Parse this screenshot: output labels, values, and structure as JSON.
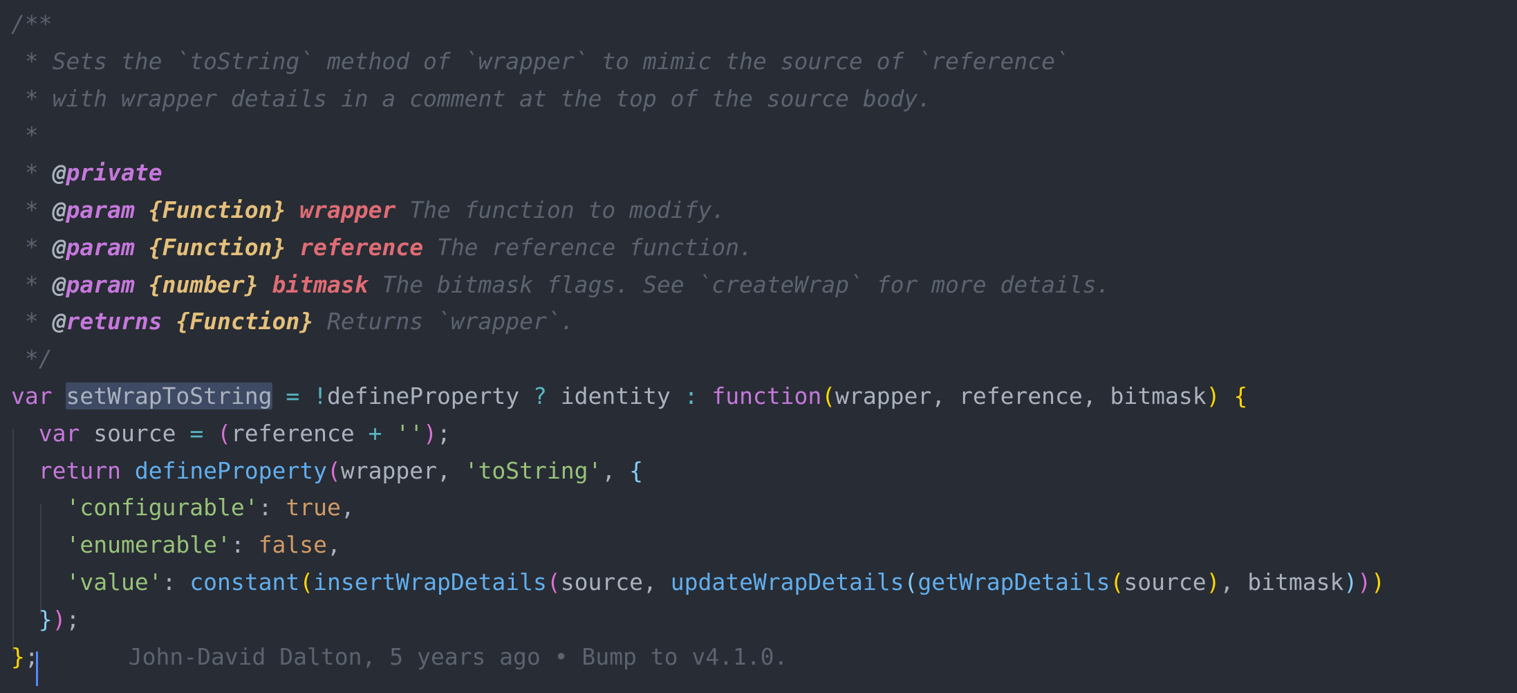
{
  "editor": {
    "theme_colors": {
      "background": "#282c34",
      "comment": "#5c6370",
      "keyword": "#c678dd",
      "function": "#61afef",
      "string": "#98c379",
      "type": "#e5c07b",
      "param": "#e06c75",
      "number_bool": "#d19a66",
      "operator": "#56b6c2",
      "bracket_gold": "#ffd700",
      "bracket_pink": "#da70d6",
      "bracket_blue": "#87cefa",
      "selection": "#3e4a63",
      "cursor": "#528bff"
    },
    "lines": [
      [
        {
          "text": "/**",
          "kind": "comment"
        }
      ],
      [
        {
          "text": " * Sets the `toString` method of `wrapper` to mimic the source of `reference`",
          "kind": "comment"
        }
      ],
      [
        {
          "text": " * with wrapper details in a comment at the top of the source body.",
          "kind": "comment"
        }
      ],
      [
        {
          "text": " *",
          "kind": "comment"
        }
      ],
      [
        {
          "text": " * ",
          "kind": "comment"
        },
        {
          "text": "@",
          "kind": "doc-at"
        },
        {
          "text": "private",
          "kind": "doc-tag"
        }
      ],
      [
        {
          "text": " * ",
          "kind": "comment"
        },
        {
          "text": "@",
          "kind": "doc-at"
        },
        {
          "text": "param",
          "kind": "doc-tag"
        },
        {
          "text": " ",
          "kind": "comment"
        },
        {
          "text": "{Function}",
          "kind": "doc-type"
        },
        {
          "text": " ",
          "kind": "comment"
        },
        {
          "text": "wrapper",
          "kind": "doc-param"
        },
        {
          "text": " The function to modify.",
          "kind": "comment"
        }
      ],
      [
        {
          "text": " * ",
          "kind": "comment"
        },
        {
          "text": "@",
          "kind": "doc-at"
        },
        {
          "text": "param",
          "kind": "doc-tag"
        },
        {
          "text": " ",
          "kind": "comment"
        },
        {
          "text": "{Function}",
          "kind": "doc-type"
        },
        {
          "text": " ",
          "kind": "comment"
        },
        {
          "text": "reference",
          "kind": "doc-param"
        },
        {
          "text": " The reference function.",
          "kind": "comment"
        }
      ],
      [
        {
          "text": " * ",
          "kind": "comment"
        },
        {
          "text": "@",
          "kind": "doc-at"
        },
        {
          "text": "param",
          "kind": "doc-tag"
        },
        {
          "text": " ",
          "kind": "comment"
        },
        {
          "text": "{number}",
          "kind": "doc-type"
        },
        {
          "text": " ",
          "kind": "comment"
        },
        {
          "text": "bitmask",
          "kind": "doc-param"
        },
        {
          "text": " The bitmask flags. See `createWrap` for more details.",
          "kind": "comment"
        }
      ],
      [
        {
          "text": " * ",
          "kind": "comment"
        },
        {
          "text": "@",
          "kind": "doc-at"
        },
        {
          "text": "returns",
          "kind": "doc-tag"
        },
        {
          "text": " ",
          "kind": "comment"
        },
        {
          "text": "{Function}",
          "kind": "doc-type"
        },
        {
          "text": " Returns `wrapper`.",
          "kind": "comment"
        }
      ],
      [
        {
          "text": " */",
          "kind": "comment"
        }
      ],
      [
        {
          "text": "var",
          "kind": "keyword"
        },
        {
          "text": " ",
          "kind": "plain"
        },
        {
          "text": "setWrapToString",
          "kind": "selected"
        },
        {
          "text": " ",
          "kind": "plain"
        },
        {
          "text": "=",
          "kind": "operator"
        },
        {
          "text": " ",
          "kind": "plain"
        },
        {
          "text": "!",
          "kind": "operator"
        },
        {
          "text": "defineProperty ",
          "kind": "plain"
        },
        {
          "text": "?",
          "kind": "operator"
        },
        {
          "text": " identity ",
          "kind": "plain"
        },
        {
          "text": ":",
          "kind": "operator"
        },
        {
          "text": " ",
          "kind": "plain"
        },
        {
          "text": "function",
          "kind": "keyword"
        },
        {
          "text": "(",
          "kind": "bracket-gold"
        },
        {
          "text": "wrapper, reference, bitmask",
          "kind": "plain"
        },
        {
          "text": ")",
          "kind": "bracket-gold"
        },
        {
          "text": " ",
          "kind": "plain"
        },
        {
          "text": "{",
          "kind": "bracket-gold"
        }
      ],
      [
        {
          "text": "  ",
          "kind": "plain"
        },
        {
          "text": "var",
          "kind": "keyword"
        },
        {
          "text": " source ",
          "kind": "plain"
        },
        {
          "text": "=",
          "kind": "operator"
        },
        {
          "text": " ",
          "kind": "plain"
        },
        {
          "text": "(",
          "kind": "bracket-pink"
        },
        {
          "text": "reference ",
          "kind": "plain"
        },
        {
          "text": "+",
          "kind": "operator"
        },
        {
          "text": " ",
          "kind": "plain"
        },
        {
          "text": "''",
          "kind": "string"
        },
        {
          "text": ")",
          "kind": "bracket-pink"
        },
        {
          "text": ";",
          "kind": "plain"
        }
      ],
      [
        {
          "text": "  ",
          "kind": "plain"
        },
        {
          "text": "return",
          "kind": "keyword"
        },
        {
          "text": " ",
          "kind": "plain"
        },
        {
          "text": "defineProperty",
          "kind": "function"
        },
        {
          "text": "(",
          "kind": "bracket-pink"
        },
        {
          "text": "wrapper, ",
          "kind": "plain"
        },
        {
          "text": "'toString'",
          "kind": "string"
        },
        {
          "text": ", ",
          "kind": "plain"
        },
        {
          "text": "{",
          "kind": "bracket-blue"
        }
      ],
      [
        {
          "text": "    ",
          "kind": "plain"
        },
        {
          "text": "'configurable'",
          "kind": "string"
        },
        {
          "text": ": ",
          "kind": "plain"
        },
        {
          "text": "true",
          "kind": "number"
        },
        {
          "text": ",",
          "kind": "plain"
        }
      ],
      [
        {
          "text": "    ",
          "kind": "plain"
        },
        {
          "text": "'enumerable'",
          "kind": "string"
        },
        {
          "text": ": ",
          "kind": "plain"
        },
        {
          "text": "false",
          "kind": "number"
        },
        {
          "text": ",",
          "kind": "plain"
        }
      ],
      [
        {
          "text": "    ",
          "kind": "plain"
        },
        {
          "text": "'value'",
          "kind": "string"
        },
        {
          "text": ": ",
          "kind": "plain"
        },
        {
          "text": "constant",
          "kind": "function"
        },
        {
          "text": "(",
          "kind": "bracket-gold"
        },
        {
          "text": "insertWrapDetails",
          "kind": "function"
        },
        {
          "text": "(",
          "kind": "bracket-pink"
        },
        {
          "text": "source, ",
          "kind": "plain"
        },
        {
          "text": "updateWrapDetails",
          "kind": "function"
        },
        {
          "text": "(",
          "kind": "bracket-blue"
        },
        {
          "text": "getWrapDetails",
          "kind": "function"
        },
        {
          "text": "(",
          "kind": "bracket-gold"
        },
        {
          "text": "source",
          "kind": "plain"
        },
        {
          "text": ")",
          "kind": "bracket-gold"
        },
        {
          "text": ", bitmask",
          "kind": "plain"
        },
        {
          "text": ")",
          "kind": "bracket-blue"
        },
        {
          "text": ")",
          "kind": "bracket-pink"
        },
        {
          "text": ")",
          "kind": "bracket-gold"
        }
      ],
      [
        {
          "text": "  ",
          "kind": "plain"
        },
        {
          "text": "}",
          "kind": "bracket-blue"
        },
        {
          "text": ")",
          "kind": "bracket-pink"
        },
        {
          "text": ";",
          "kind": "plain"
        }
      ],
      [
        {
          "text": "}",
          "kind": "bracket-gold"
        },
        {
          "text": ";",
          "kind": "plain"
        }
      ]
    ],
    "blame": "John-David Dalton, 5 years ago • Bump to v4.1.0."
  }
}
